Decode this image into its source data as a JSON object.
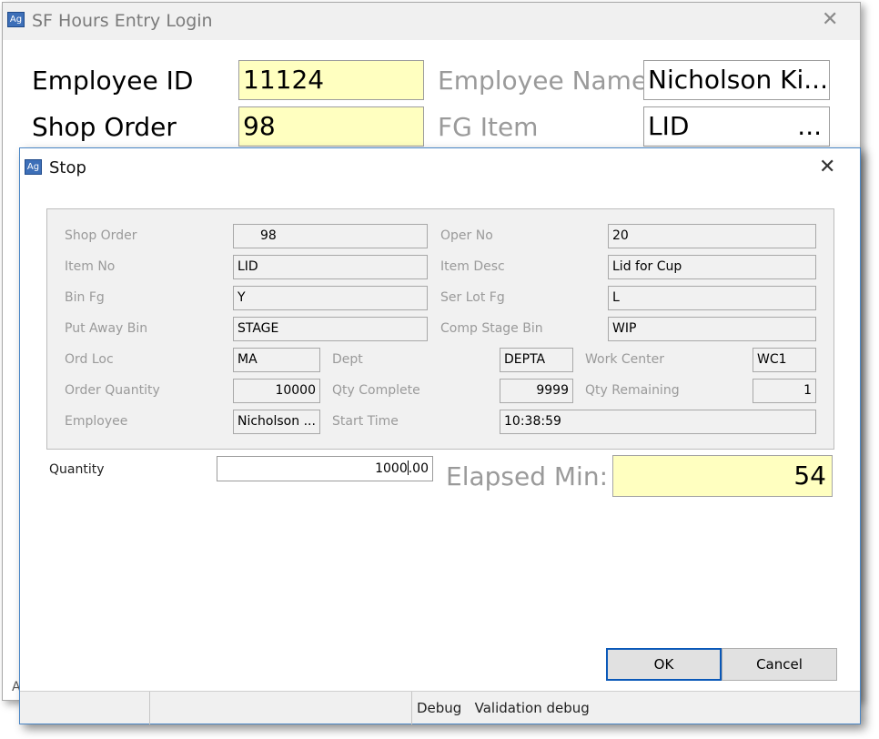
{
  "background_window": {
    "icon_text": "Ag",
    "title": "SF Hours Entry Login",
    "fields": {
      "employee_id_label": "Employee ID",
      "employee_id_value": "11124",
      "employee_name_label": "Employee Name",
      "employee_name_value": "Nicholson Ki...",
      "shop_order_label": "Shop Order",
      "shop_order_value": "98",
      "fg_item_label": "FG Item",
      "fg_item_value": "LID",
      "fg_item_ellipsis": "..."
    },
    "bottom_edge_text": "A"
  },
  "dialog": {
    "icon_text": "Ag",
    "title": "Stop",
    "fields": {
      "shop_order": {
        "label": "Shop Order",
        "value": "98"
      },
      "oper_no": {
        "label": "Oper No",
        "value": "20"
      },
      "item_no": {
        "label": "Item No",
        "value": "LID"
      },
      "item_desc": {
        "label": "Item Desc",
        "value": "Lid for Cup"
      },
      "bin_fg": {
        "label": "Bin Fg",
        "value": "Y"
      },
      "ser_lot_fg": {
        "label": "Ser Lot Fg",
        "value": "L"
      },
      "put_away_bin": {
        "label": "Put Away Bin",
        "value": "STAGE"
      },
      "comp_stage_bin": {
        "label": "Comp Stage Bin",
        "value": "WIP"
      },
      "ord_loc": {
        "label": "Ord Loc",
        "value": "MA"
      },
      "dept": {
        "label": "Dept",
        "value": "DEPTA"
      },
      "work_center": {
        "label": "Work Center",
        "value": "WC1"
      },
      "order_quantity": {
        "label": "Order Quantity",
        "value": "10000"
      },
      "qty_complete": {
        "label": "Qty Complete",
        "value": "9999"
      },
      "qty_remaining": {
        "label": "Qty Remaining",
        "value": "1"
      },
      "employee": {
        "label": "Employee",
        "value": "Nicholson ..."
      },
      "start_time": {
        "label": "Start Time",
        "value": "10:38:59"
      }
    },
    "quantity": {
      "label": "Quantity",
      "value_before_caret": "1000",
      "value_after_caret": ".00"
    },
    "elapsed": {
      "label": "Elapsed Min:",
      "value": "54"
    },
    "buttons": {
      "ok": "OK",
      "cancel": "Cancel"
    },
    "statusbar": {
      "text": "Debug   Validation debug"
    }
  }
}
